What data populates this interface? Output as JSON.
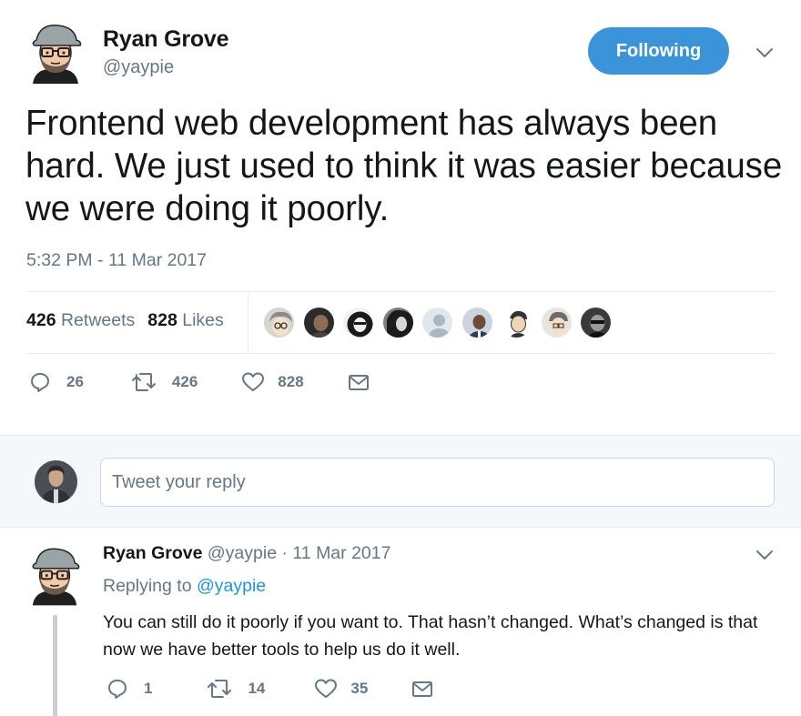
{
  "tweet": {
    "author_name": "Ryan Grove",
    "author_handle": "@yaypie",
    "follow_label": "Following",
    "text": "Frontend web development has always been hard. We just used to think it was easier because we were doing it poorly.",
    "timestamp": "5:32 PM - 11 Mar 2017",
    "retweets_count": "426",
    "retweets_label": "Retweets",
    "likes_count": "828",
    "likes_label": "Likes",
    "actions": {
      "reply_count": "26",
      "retweet_count": "426",
      "like_count": "828"
    }
  },
  "reply_box": {
    "placeholder": "Tweet your reply"
  },
  "reply_tweet": {
    "author_name": "Ryan Grove",
    "author_handle": "@yaypie",
    "separator": "·",
    "date": "11 Mar 2017",
    "replying_prefix": "Replying to",
    "replying_to": "@yaypie",
    "text": "You can still do it poorly if you want to. That hasn’t changed. What’s changed is that now we have better tools to help us do it well.",
    "actions": {
      "reply_count": "1",
      "retweet_count": "14",
      "like_count": "35"
    }
  },
  "icons": {
    "reply": "reply-icon",
    "retweet": "retweet-icon",
    "like": "heart-icon",
    "dm": "envelope-icon",
    "more": "chevron-down-icon"
  },
  "colors": {
    "accent": "#3b94d9",
    "link": "#1b95e0",
    "muted": "#657786",
    "text": "#14171a"
  }
}
